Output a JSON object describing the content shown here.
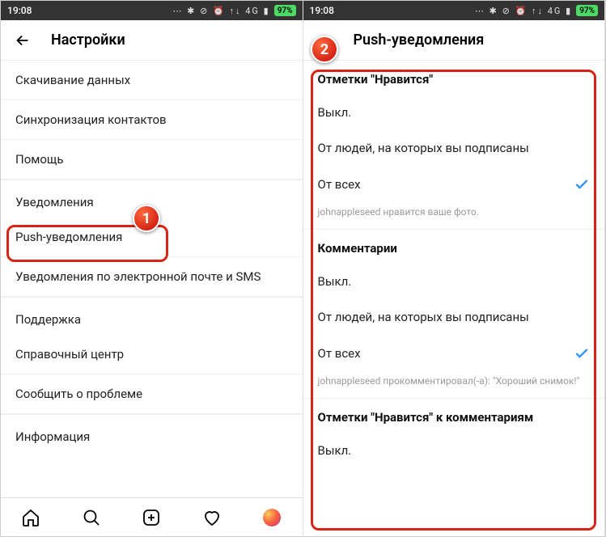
{
  "status": {
    "time": "19:08",
    "icons": "⋯ ✱ ⊘ ⏰ ↑↓ 4G ▮",
    "battery": "97%"
  },
  "left": {
    "title": "Настройки",
    "rows_top": [
      "Скачивание данных",
      "Синхронизация контактов",
      "Помощь"
    ],
    "section_notifications": "Уведомления",
    "row_push": "Push-уведомления",
    "row_email_sms": "Уведомления по электронной почте и SMS",
    "section_support": "Поддержка",
    "row_help_center": "Справочный центр",
    "row_report": "Сообщить о проблеме",
    "section_info": "Информация"
  },
  "right": {
    "title": "Push-уведомления",
    "g1": {
      "header": "Отметки \"Нравится\"",
      "opt_off": "Выкл.",
      "opt_following": "От людей, на которых вы подписаны",
      "opt_all": "От всех",
      "helper": "johnappleseed нравится ваше фото."
    },
    "g2": {
      "header": "Комментарии",
      "opt_off": "Выкл.",
      "opt_following": "От людей, на которых вы подписаны",
      "opt_all": "От всех",
      "helper": "johnappleseed прокомментировал(-а): \"Хороший снимок!\""
    },
    "g3": {
      "header": "Отметки \"Нравится\" к комментариям",
      "opt_off": "Выкл."
    }
  },
  "callouts": {
    "one": "1",
    "two": "2"
  }
}
